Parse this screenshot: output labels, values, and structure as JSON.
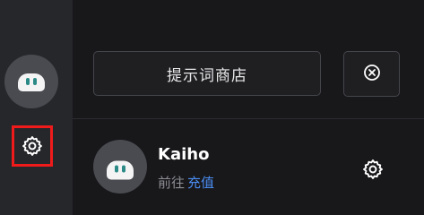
{
  "sidebar": {
    "avatar_icon": "robot-avatar-icon",
    "settings_icon": "gear-icon",
    "settings_highlight_color": "#ef1b1b"
  },
  "main": {
    "prompt_store_label": "提示词商店",
    "close_icon": "close-circle-icon"
  },
  "profile": {
    "username": "Kaiho",
    "go_to_text": "前往",
    "recharge_link": "充值",
    "link_color": "#4a8cf0",
    "settings_icon": "gear-icon"
  }
}
